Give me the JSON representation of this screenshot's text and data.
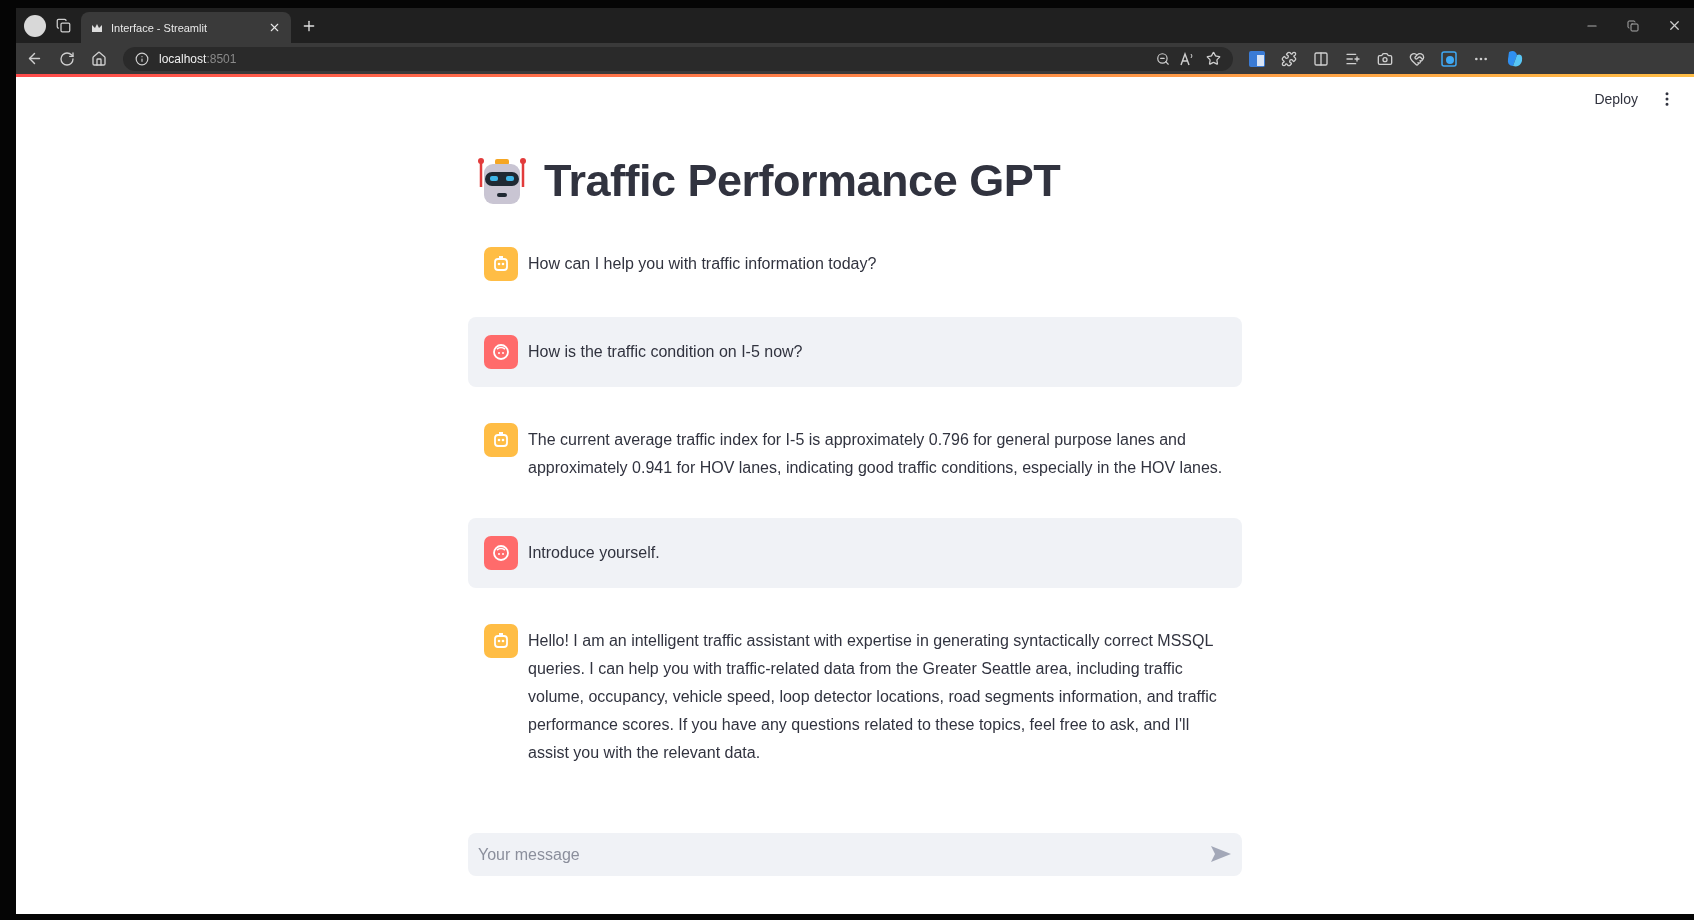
{
  "browser": {
    "tab": {
      "title": "Interface - Streamlit",
      "selected": true
    },
    "url": {
      "host": "localhost",
      "port": ":8501"
    }
  },
  "app": {
    "deploy": "Deploy",
    "title": "Traffic Performance GPT"
  },
  "messages": [
    {
      "kind": "assistant",
      "text": "How can I help you with traffic information today?"
    },
    {
      "kind": "user",
      "text": "How is the traffic condition on I-5 now?"
    },
    {
      "kind": "assistant",
      "text": "The current average traffic index for I-5 is approximately 0.796 for general purpose lanes and approximately 0.941 for HOV lanes, indicating good traffic conditions, especially in the HOV lanes."
    },
    {
      "kind": "user",
      "text": "Introduce yourself."
    },
    {
      "kind": "assistant",
      "text": "Hello! I am an intelligent traffic assistant with expertise in generating syntactically correct MSSQL queries. I can help you with traffic-related data from the Greater Seattle area, including traffic volume, occupancy, vehicle speed, loop detector locations, road segments information, and traffic performance scores. If you have any questions related to these topics, feel free to ask, and I'll assist you with the relevant data."
    }
  ],
  "chat_input": {
    "placeholder": "Your message"
  }
}
